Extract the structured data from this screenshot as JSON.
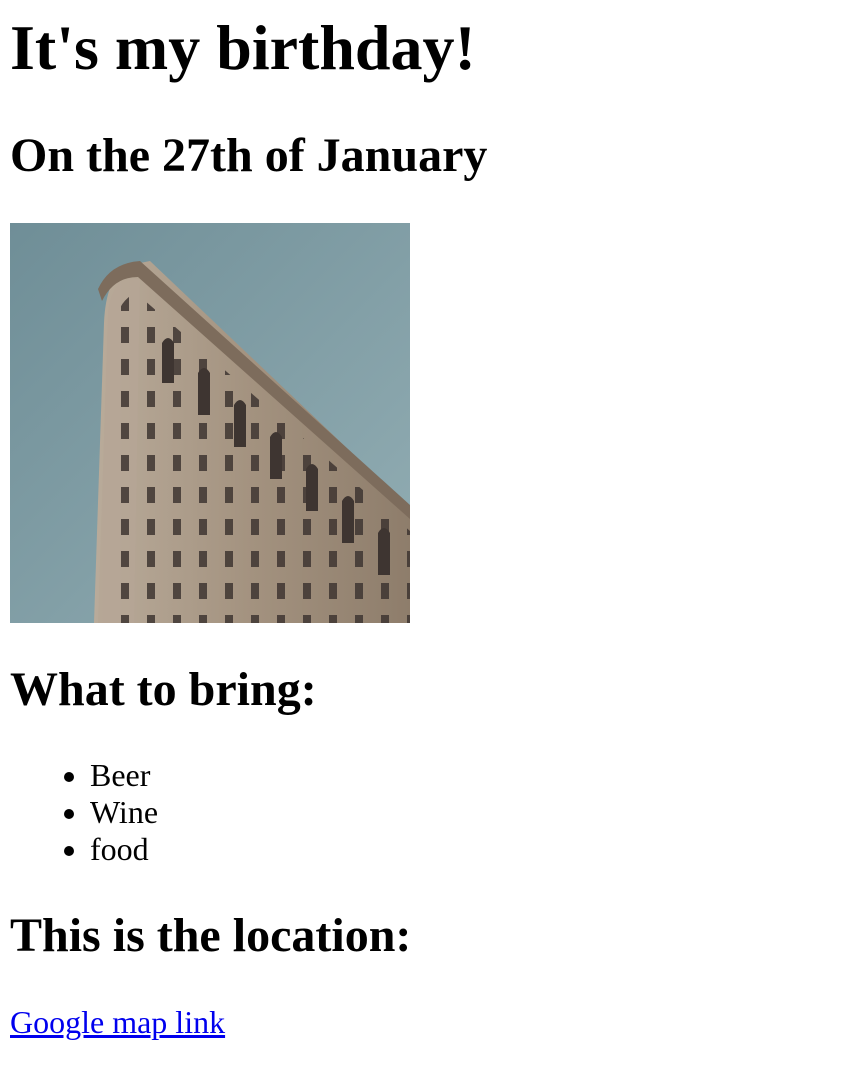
{
  "page": {
    "title": "It's my birthday!",
    "date_heading": "On the 27th of January",
    "photo_alt": "Flatiron Building",
    "bring_heading": "What to bring:",
    "bring_items": [
      "Beer",
      "Wine",
      "food"
    ],
    "location_heading": "This is the location:",
    "map_link_text": "Google map link"
  },
  "colors": {
    "text": "#000000",
    "link": "#0000ee",
    "sky": "#7f9ea6",
    "building": "#a89a8a"
  }
}
